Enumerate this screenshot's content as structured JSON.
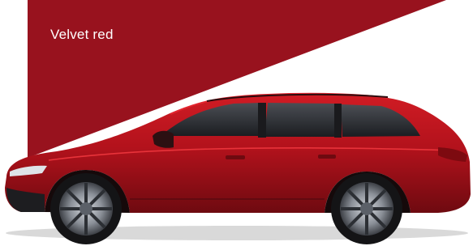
{
  "swatch": {
    "name": "Velvet red",
    "color": "#98121e"
  },
  "vehicle": {
    "icon": "estate-car-side-profile",
    "body_color": "#b3121c",
    "highlight_color": "#e2252e"
  }
}
